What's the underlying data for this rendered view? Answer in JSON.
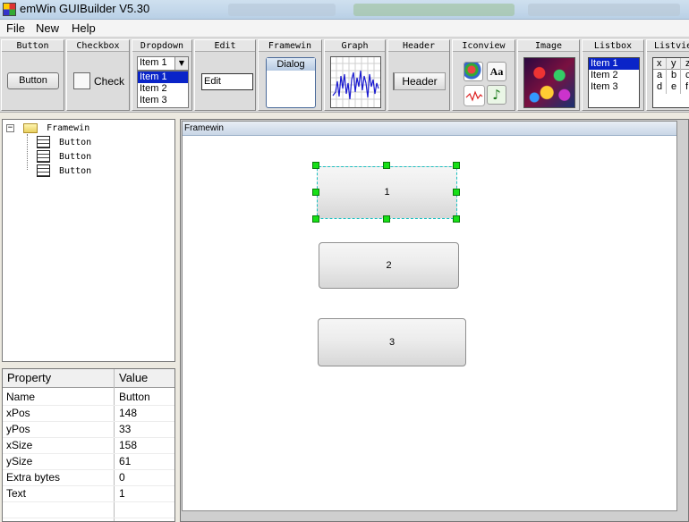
{
  "window": {
    "title": "emWin GUIBuilder V5.30"
  },
  "menu": [
    "File",
    "New",
    "Help"
  ],
  "toolbox": {
    "button": {
      "label": "Button",
      "sample": "Button"
    },
    "checkbox": {
      "label": "Checkbox",
      "sample": "Check"
    },
    "dropdown": {
      "label": "Dropdown",
      "selected": "Item 1",
      "items": [
        "Item 1",
        "Item 2",
        "Item 3"
      ]
    },
    "edit": {
      "label": "Edit",
      "sample": "Edit"
    },
    "framewin": {
      "label": "Framewin",
      "sample": "Dialog"
    },
    "graph": {
      "label": "Graph"
    },
    "header": {
      "label": "Header",
      "sample": "Header"
    },
    "iconview": {
      "label": "Iconview",
      "icons": [
        "book-icon",
        "font-icon",
        "waveform-icon",
        "music-note-icon"
      ],
      "font_glyph": "Aa"
    },
    "image": {
      "label": "Image"
    },
    "listbox": {
      "label": "Listbox",
      "items": [
        "Item 1",
        "Item 2",
        "Item 3"
      ]
    },
    "listview": {
      "label": "Listview",
      "columns": [
        "x",
        "y",
        "z"
      ],
      "rows": [
        [
          "a",
          "b",
          "c"
        ],
        [
          "d",
          "e",
          "f"
        ]
      ]
    }
  },
  "tree": {
    "root": "Framewin",
    "children": [
      "Button",
      "Button",
      "Button"
    ]
  },
  "properties": {
    "header": {
      "property": "Property",
      "value": "Value"
    },
    "rows": [
      {
        "name": "Name",
        "value": "Button"
      },
      {
        "name": "xPos",
        "value": "148"
      },
      {
        "name": "yPos",
        "value": "33"
      },
      {
        "name": "xSize",
        "value": "158"
      },
      {
        "name": "ySize",
        "value": "61"
      },
      {
        "name": "Extra bytes",
        "value": "0"
      },
      {
        "name": "Text",
        "value": "1"
      }
    ]
  },
  "canvas": {
    "framewin_title": "Framewin",
    "buttons": [
      "1",
      "2",
      "3"
    ]
  },
  "colors": {
    "selection": "#0a24c8",
    "handle": "#17e017",
    "selection_outline": "#19c0c0"
  }
}
